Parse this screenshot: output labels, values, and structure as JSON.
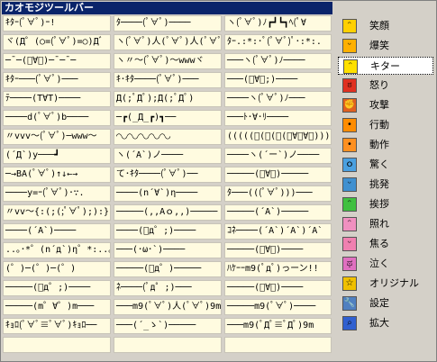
{
  "window": {
    "title": "カオモジツールバー"
  },
  "kaomoji_rows": [
    [
      "ｷﾀｰ(ﾟ∀ﾟ)ｰ!",
      "ﾀ────(ﾟ∀ﾟ)────",
      "ヽ(ﾟ∀ﾟ)ﾉ┏┛┗┓ﾍ(ﾟ∀"
    ],
    [
      "ヾ(Д゜(○=(ﾟ∀ﾟ)=○)Дﾞ",
      "ヽ(ﾟ∀ﾟ)人(ﾟ∀ﾟ)人(ﾟ∀ﾟ",
      "ﾀｰ.:*:･ﾟ(ﾟ∀ﾟ)ﾟ･:*:."
    ],
    [
      "─¯─(ﾟ∀ﾟ)─¯─¯─",
      "ヽ〃〜(ﾟ∀ﾟ)〜wwwヾ",
      "───ヽ(ﾟ∀ﾟ)ﾉ────"
    ],
    [
      "ｷﾀｰ───(ﾟ∀ﾟ)───",
      "ｷ･ｷﾀ────(ﾟ∀ﾟ)───",
      "───(ﾟ∀ﾟ;)────"
    ],
    [
      "ﾃ────(T∀T)────",
      "Д(;ﾟДﾟ);Д(;ﾟДﾟ)",
      "────ヽ(ﾟ∀ﾟ)ﾉ───"
    ],
    [
      "────d(ﾟ∀ﾟ)b────",
      "─┏(_Д_┏)┓──",
      "───ﾄ･∀･ﾘ────"
    ],
    [
      "〃vvv〜(ﾟ∀ﾟ)─www〜",
      "◠◡◠◡◠◡◠◡◠◡",
      "(((((ﾟ(ﾟ(ﾟ(ﾟ∀ﾟ∀ﾟ))))"
    ],
    [
      "(´Д`)y───┛",
      "ヽ(´A`)ノ────",
      "────ヽ(´ー`)ノ────"
    ],
    [
      "─→BA(ﾟ∀ﾟ)↑↓←→",
      "て･ｷﾀ────(ﾟ∀ﾟ)──",
      "─────(ﾟ∀ﾟ)─────"
    ],
    [
      "────y=ｰ(ﾟ∀ﾟ)･∵.",
      "────(n´∀`)η────",
      "ﾀ───(((ﾟ∀ﾟ)))───"
    ],
    [
      "〃vv〜{:(;(;ﾟ∀ﾟ);):}",
      "─────(,,Aｏ,,)─────",
      "─────(´A`)─────"
    ],
    [
      "────(´A`)────",
      "────(ﾟд゜;)────",
      "ｺﾈ────(´A`)´A`)´A`"
    ],
    [
      "..｡･*゜(n´д`)η゜*:..｡",
      "───(･ω･`)────",
      "─────(ﾟ∀ﾟ)────"
    ],
    [
      "(゜)─(゜)─(゜)",
      "─────(ﾟд゜)─────",
      "ﾊｹｰｰm9(ﾟдﾟ)っーン!!"
    ],
    [
      "─────(ﾟд゜;)────",
      "ﾈ────(ﾟд゜;)───",
      "─────(ﾟ∀ﾟ)────"
    ],
    [
      "─────(m゜∀゜)m───",
      "───m9(ﾟ∀ﾟ)人(ﾟ∀ﾟ)9m",
      "─────m9(ﾟ∀ﾟ)────"
    ],
    [
      "ｷｮﾛ(ﾟ∀ﾟ≡ﾟ∀ﾟ)ｷｮﾛ──",
      "───(´_ゝ`)─────",
      "───m9(ﾟДﾟ≡ﾟДﾟ)9m"
    ],
    [
      "",
      "",
      ""
    ]
  ],
  "categories": [
    {
      "label": "笑顔",
      "icon": "smile-face-icon",
      "color": "#ffd000",
      "glyph": "ᵔ"
    },
    {
      "label": "爆笑",
      "icon": "laugh-face-icon",
      "color": "#ffb000",
      "glyph": "ᵕ"
    },
    {
      "label": "キター",
      "icon": "kita-face-icon",
      "color": "#ffe000",
      "glyph": "ᵔ",
      "selected": true
    },
    {
      "label": "怒り",
      "icon": "angry-face-icon",
      "color": "#e03020",
      "glyph": "ಠ"
    },
    {
      "label": "攻撃",
      "icon": "attack-icon",
      "color": "#e06020",
      "glyph": "✊"
    },
    {
      "label": "行動",
      "icon": "action-icon",
      "color": "#ff8c00",
      "glyph": "•"
    },
    {
      "label": "動作",
      "icon": "movement-icon",
      "color": "#ff9020",
      "glyph": "•"
    },
    {
      "label": "驚く",
      "icon": "surprised-icon",
      "color": "#4aa0e0",
      "glyph": "ｏ"
    },
    {
      "label": "挑発",
      "icon": "provoke-icon",
      "color": "#4090d0",
      "glyph": "ᵕ"
    },
    {
      "label": "挨拶",
      "icon": "greeting-icon",
      "color": "#40c040",
      "glyph": "ᵔ"
    },
    {
      "label": "照れ",
      "icon": "shy-icon",
      "color": "#f090c0",
      "glyph": "ᵔ"
    },
    {
      "label": "焦る",
      "icon": "panic-icon",
      "color": "#f080b0",
      "glyph": "ᵕ"
    },
    {
      "label": "泣く",
      "icon": "cry-icon",
      "color": "#e070c0",
      "glyph": "ಥ"
    },
    {
      "label": "オリジナル",
      "icon": "star-icon",
      "color": "#f0c000",
      "glyph": "☆"
    },
    {
      "label": "設定",
      "icon": "wrench-icon",
      "color": "#5080c0",
      "glyph": "🔧"
    },
    {
      "label": "拡大",
      "icon": "magnifier-icon",
      "color": "#3060d0",
      "glyph": "⌕"
    }
  ]
}
